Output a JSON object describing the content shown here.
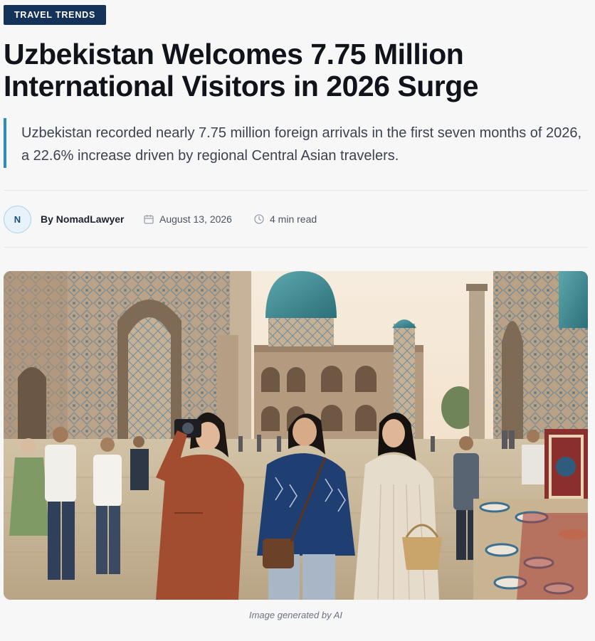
{
  "article": {
    "category": "TRAVEL TRENDS",
    "title": "Uzbekistan Welcomes 7.75 Million International Visitors in 2026 Surge",
    "lede": "Uzbekistan recorded nearly 7.75 million foreign arrivals in the first seven months of 2026, a 22.6% increase driven by regional Central Asian travelers.",
    "author": {
      "initial": "N",
      "byline": "By NomadLawyer"
    },
    "date": "August 13, 2026",
    "read_time": "4 min read",
    "image_caption": "Image generated by AI"
  },
  "icons": {
    "date": "calendar-icon",
    "read_time": "clock-icon"
  },
  "colors": {
    "tag_bg": "#15325a",
    "accent_border": "#2a8ec5",
    "avatar_bg": "#e7f2fb"
  }
}
